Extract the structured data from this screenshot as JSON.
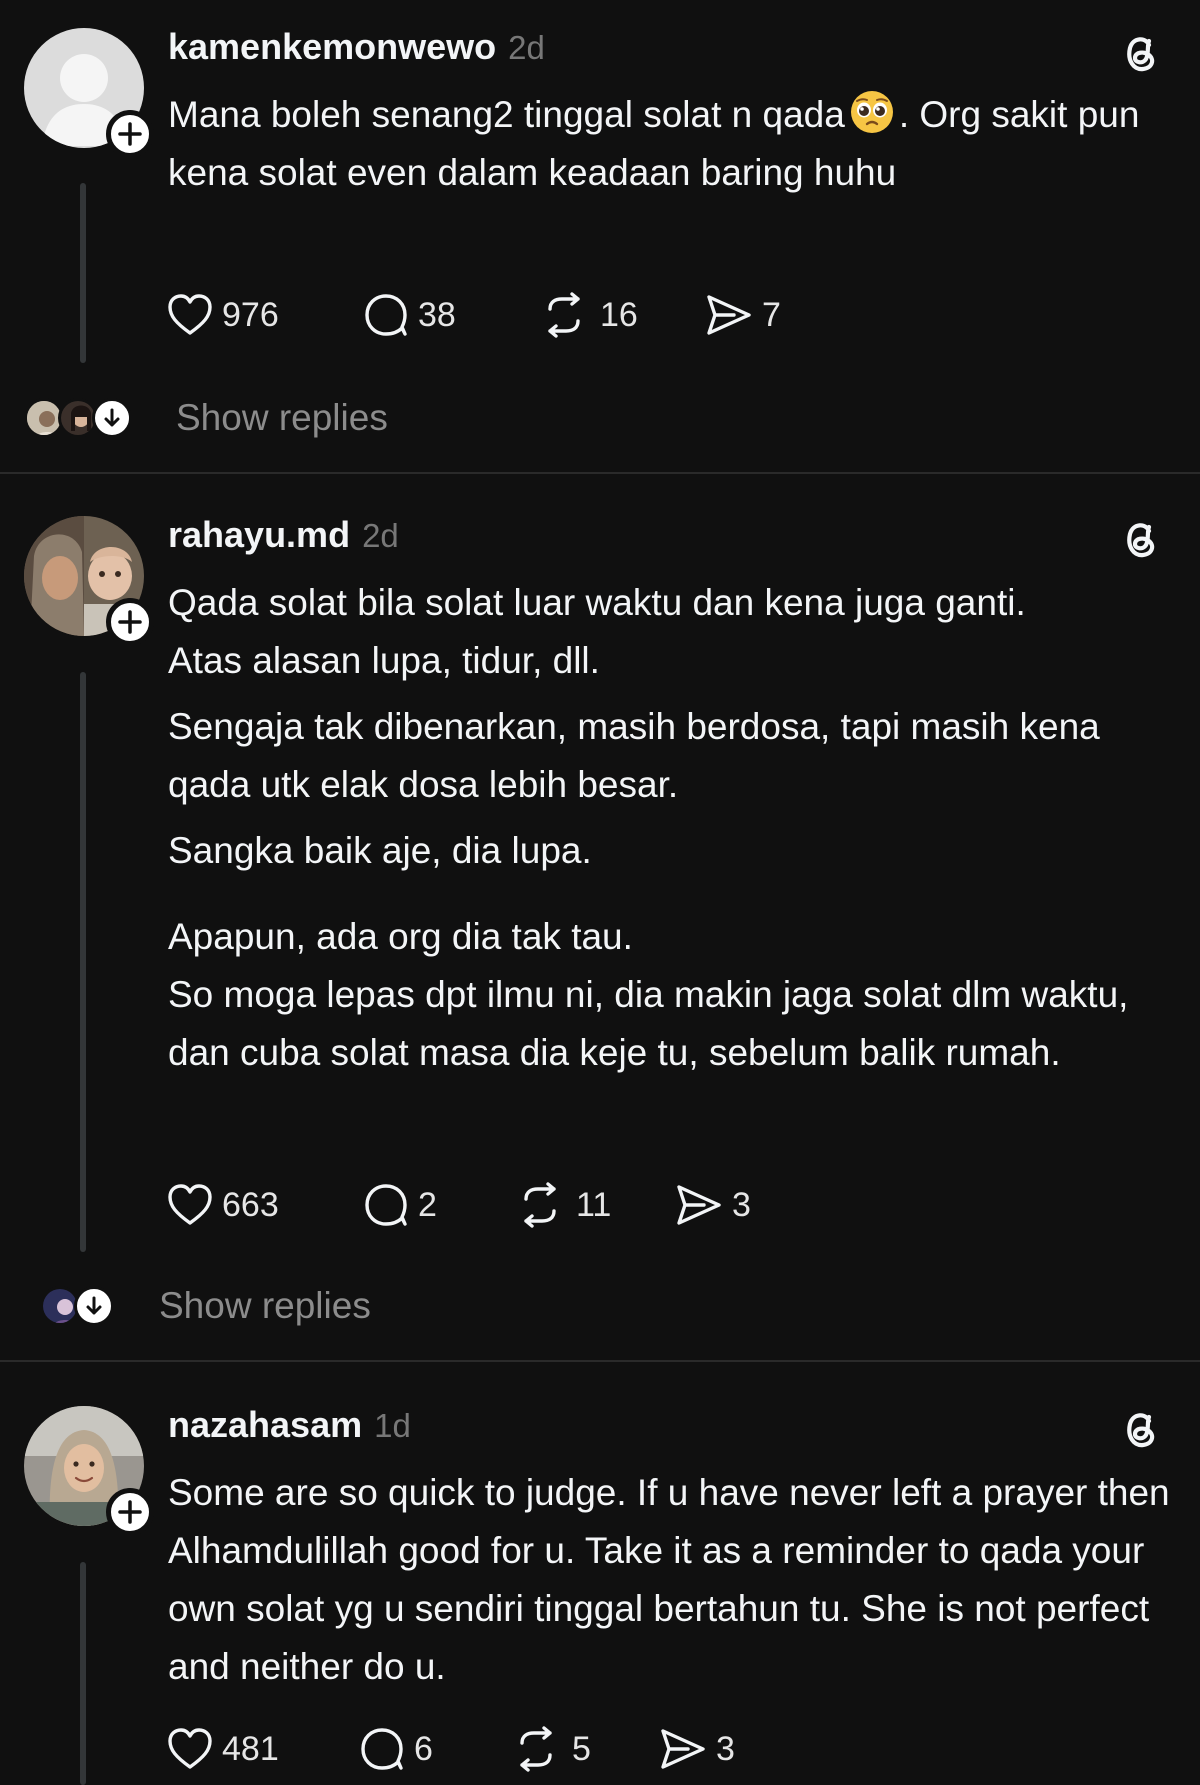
{
  "posts": [
    {
      "username": "kamenkemonwewo",
      "time": "2d",
      "paragraphs": [
        "Mana boleh senang2 tinggal solat n qada",
        ". Org sakit pun kena solat even dalam keadaan baring huhu"
      ],
      "emoji": "pleading-face-emoji",
      "likes": "976",
      "comments": "38",
      "reposts": "16",
      "shares": "7",
      "show_replies": "Show replies"
    },
    {
      "username": "rahayu.md",
      "time": "2d",
      "paragraphs": [
        "Qada solat bila solat luar waktu dan kena juga ganti.\nAtas alasan lupa, tidur, dll.",
        "Sengaja tak dibenarkan, masih berdosa, tapi masih kena qada utk elak dosa lebih besar.",
        "Sangka baik aje, dia lupa.",
        "Apapun, ada org dia tak tau.\nSo moga lepas dpt ilmu ni, dia makin jaga solat dlm waktu, dan cuba solat masa dia keje tu, sebelum balik rumah."
      ],
      "likes": "663",
      "comments": "2",
      "reposts": "11",
      "shares": "3",
      "show_replies": "Show replies"
    },
    {
      "username": "nazahasam",
      "time": "1d",
      "paragraphs": [
        "Some are so quick to judge. If u have never left a prayer then Alhamdulillah good for u. Take it as a reminder to qada your own solat yg u sendiri tinggal bertahun tu. She is not perfect and neither do u."
      ],
      "likes": "481",
      "comments": "6",
      "reposts": "5",
      "shares": "3"
    }
  ],
  "colors": {
    "background": "#101010",
    "text": "#f3f5f7",
    "muted": "#777777",
    "divider": "#2a2a2a"
  },
  "icons": [
    "threads-logo-icon",
    "plus-icon",
    "heart-icon",
    "comment-icon",
    "repost-icon",
    "share-icon",
    "arrow-down-icon"
  ]
}
